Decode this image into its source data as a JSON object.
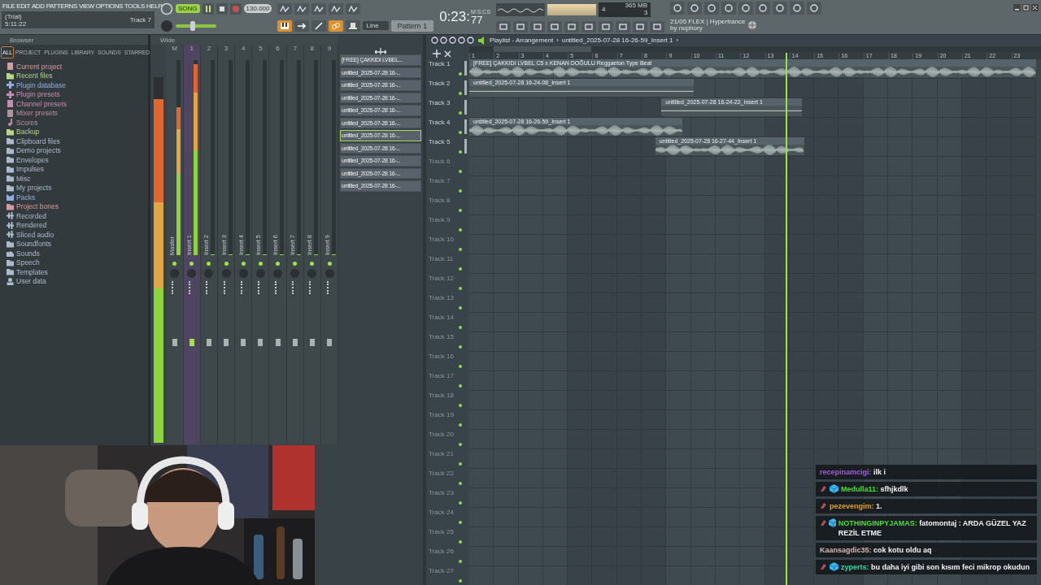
{
  "menu": [
    "FILE",
    "EDIT",
    "ADD",
    "PATTERNS",
    "VIEW",
    "OPTIONS",
    "TOOLS",
    "HELP"
  ],
  "hint": {
    "line1": "(Trial)",
    "line2": "5:11:22",
    "track": "Track 7"
  },
  "transport": {
    "song_label": "SONG",
    "song_mode": true,
    "recording": false,
    "tempo": "130.000",
    "pitch": {
      "level": 0.42
    }
  },
  "clock": {
    "time": "0:23:",
    "centis": "77",
    "unit": "M:S:CS"
  },
  "cpu": {
    "voices": "4",
    "memory": "365 MB",
    "polyphony": "3"
  },
  "snap": {
    "value": "Line"
  },
  "pattern": {
    "value": "Pattern 1"
  },
  "news": {
    "title": "21/05 FLEX | Hypertrance",
    "author": "by nuphory"
  },
  "browser": {
    "title": "Browser",
    "tabs": [
      {
        "label": "ALL",
        "selected": true
      },
      {
        "label": "PROJECT",
        "selected": false
      },
      {
        "label": "PLUGINS",
        "selected": false
      },
      {
        "label": "LIBRARY",
        "selected": false
      },
      {
        "label": "SOUNDS",
        "selected": false
      },
      {
        "label": "STARRED",
        "selected": false
      }
    ],
    "items": [
      {
        "label": "Current project",
        "kind": "file",
        "color": "#d69a9e"
      },
      {
        "label": "Recent files",
        "kind": "folder",
        "color": "#b9d48c"
      },
      {
        "label": "Plugin database",
        "kind": "plug",
        "color": "#93aede"
      },
      {
        "label": "Plugin presets",
        "kind": "plug",
        "color": "#c98ab0"
      },
      {
        "label": "Channel presets",
        "kind": "file",
        "color": "#c98ab0"
      },
      {
        "label": "Mixer presets",
        "kind": "file",
        "color": "#b7909e"
      },
      {
        "label": "Scores",
        "kind": "note",
        "color": "#b7909e"
      },
      {
        "label": "Backup",
        "kind": "folder",
        "color": "#b9d48c"
      },
      {
        "label": "Clipboard files",
        "kind": "folder",
        "color": "#aebacb"
      },
      {
        "label": "Demo projects",
        "kind": "folder",
        "color": "#aebacb"
      },
      {
        "label": "Envelopes",
        "kind": "folder",
        "color": "#aebacb"
      },
      {
        "label": "Impulses",
        "kind": "folder",
        "color": "#aebacb"
      },
      {
        "label": "Misc",
        "kind": "folder",
        "color": "#aebacb"
      },
      {
        "label": "My projects",
        "kind": "folder",
        "color": "#aebacb"
      },
      {
        "label": "Packs",
        "kind": "pack",
        "color": "#93aede"
      },
      {
        "label": "Project bones",
        "kind": "folder",
        "color": "#d69a9e"
      },
      {
        "label": "Recorded",
        "kind": "wave",
        "color": "#aebacb"
      },
      {
        "label": "Rendered",
        "kind": "wave",
        "color": "#aebacb"
      },
      {
        "label": "Sliced audio",
        "kind": "wave",
        "color": "#aebacb"
      },
      {
        "label": "Soundfonts",
        "kind": "folder",
        "color": "#aebacb"
      },
      {
        "label": "Sounds",
        "kind": "cloud",
        "color": "#aebacb"
      },
      {
        "label": "Speech",
        "kind": "folder",
        "color": "#aebacb"
      },
      {
        "label": "Templates",
        "kind": "folder",
        "color": "#aebacb"
      },
      {
        "label": "User data",
        "kind": "user",
        "color": "#aebacb"
      }
    ]
  },
  "mixer": {
    "mode": "Wide",
    "master_meter": {
      "level": 0.94
    },
    "channels": [
      {
        "number": "M",
        "name": "Master",
        "selected": false,
        "level": 0.76
      },
      {
        "number": "1",
        "name": "Insert 1",
        "selected": true,
        "level": 0.98
      },
      {
        "number": "2",
        "name": "Insert 2",
        "selected": false,
        "level": 0
      },
      {
        "number": "3",
        "name": "Insert 3",
        "selected": false,
        "level": 0
      },
      {
        "number": "4",
        "name": "Insert 4",
        "selected": false,
        "level": 0
      },
      {
        "number": "5",
        "name": "Insert 5",
        "selected": false,
        "level": 0
      },
      {
        "number": "6",
        "name": "Insert 6",
        "selected": false,
        "level": 0
      },
      {
        "number": "7",
        "name": "Insert 7",
        "selected": false,
        "level": 0
      },
      {
        "number": "8",
        "name": "Insert 8",
        "selected": false,
        "level": 0
      },
      {
        "number": "9",
        "name": "Insert 9",
        "selected": false,
        "level": 0
      }
    ]
  },
  "picker": [
    {
      "label": "[FREE] ÇAKKIDI LVBEL...",
      "selected": false
    },
    {
      "label": "untitled_2025-07-28 16-...",
      "selected": false
    },
    {
      "label": "untitled_2025-07-28 16-...",
      "selected": false
    },
    {
      "label": "untitled_2025-07-28 16-...",
      "selected": false
    },
    {
      "label": "untitled_2025-07-28 16-...",
      "selected": false
    },
    {
      "label": "untitled_2025-07-28 16-...",
      "selected": false
    },
    {
      "label": "untitled_2025-07-28 16-...",
      "selected": true
    },
    {
      "label": "untitled_2025-07-28 16-...",
      "selected": false
    },
    {
      "label": "untitled_2025-07-28 16-...",
      "selected": false
    },
    {
      "label": "untitled_2025-07-28 16-...",
      "selected": false
    },
    {
      "label": "untitled_2025-07-28 16-...",
      "selected": false
    }
  ],
  "playlist": {
    "title": "Playlist - Arrangement",
    "separator": "›",
    "clip_path": "untitled_2025-07-28 16-26-59_Insert 1",
    "trail": "›",
    "ruler": [
      "1",
      "2",
      "3",
      "4",
      "5",
      "6",
      "7",
      "8",
      "9",
      "10",
      "11",
      "12",
      "13",
      "14",
      "15",
      "16",
      "17",
      "18",
      "19",
      "20",
      "21",
      "22",
      "23"
    ],
    "tracks": [
      {
        "name": "Track 1",
        "dimmed": false,
        "clips": [
          {
            "name": "[FREE] ÇAKKIDI LVBEL C5 x KENAN DOĞULU Reggaeton Type Beat",
            "silent": false
          }
        ]
      },
      {
        "name": "Track 2",
        "dimmed": false,
        "clips": [
          {
            "name": "untitled_2025-07-28 16-24-08_Insert 1",
            "silent": true
          }
        ]
      },
      {
        "name": "Track 3",
        "dimmed": false,
        "clips": [
          {
            "name": "untitled_2025-07-28 16-24-22_Insert 1",
            "silent": true
          }
        ]
      },
      {
        "name": "Track 4",
        "dimmed": false,
        "clips": [
          {
            "name": "untitled_2025-07-28 16-26-59_Insert 1",
            "silent": false
          }
        ]
      },
      {
        "name": "Track 5",
        "dimmed": false,
        "clips": [
          {
            "name": "untitled_2025-07-28 16-27-44_Insert 1",
            "silent": false
          }
        ]
      },
      {
        "name": "Track 6",
        "dimmed": true
      },
      {
        "name": "Track 7",
        "dimmed": true
      },
      {
        "name": "Track 8",
        "dimmed": true
      },
      {
        "name": "Track 9",
        "dimmed": true
      },
      {
        "name": "Track 10",
        "dimmed": true
      },
      {
        "name": "Track 11",
        "dimmed": true
      },
      {
        "name": "Track 12",
        "dimmed": true
      },
      {
        "name": "Track 13",
        "dimmed": true
      },
      {
        "name": "Track 14",
        "dimmed": true
      },
      {
        "name": "Track 15",
        "dimmed": true
      },
      {
        "name": "Track 16",
        "dimmed": true
      },
      {
        "name": "Track 17",
        "dimmed": true
      },
      {
        "name": "Track 18",
        "dimmed": true
      },
      {
        "name": "Track 19",
        "dimmed": true
      },
      {
        "name": "Track 20",
        "dimmed": true
      },
      {
        "name": "Track 21",
        "dimmed": true
      },
      {
        "name": "Track 22",
        "dimmed": true
      },
      {
        "name": "Track 23",
        "dimmed": true
      },
      {
        "name": "Track 24",
        "dimmed": true
      },
      {
        "name": "Track 25",
        "dimmed": true
      },
      {
        "name": "Track 26",
        "dimmed": true
      },
      {
        "name": "Track 27",
        "dimmed": true
      }
    ]
  },
  "chat": [
    {
      "user": "recepinamcigi:",
      "text": "ilk i",
      "color": "#a45de0",
      "badge_pick": false,
      "badge_cube": false
    },
    {
      "user": "Medulla11:",
      "text": "sfhjkdlk",
      "color": "#4fdc3c",
      "badge_pick": true,
      "badge_cube": true
    },
    {
      "user": "pezevengim:",
      "text": "1.",
      "color": "#e0a030",
      "badge_pick": true,
      "badge_cube": false
    },
    {
      "user": "NOTHINGINPYJAMAS:",
      "text": "fatomontaj : ARDA GÜZEL YAZ REZİL ETME",
      "color": "#4fdc3c",
      "badge_pick": true,
      "badge_cube": true
    },
    {
      "user": "Kaansagdic35:",
      "text": "cok kotu oldu aq",
      "color": "#d9b8b8",
      "badge_pick": false,
      "badge_cube": false
    },
    {
      "user": "zyperts:",
      "text": "bu daha iyi gibi son kısım feci mikrop okudun",
      "color": "#3fd6a0",
      "badge_pick": true,
      "badge_cube": true
    }
  ]
}
